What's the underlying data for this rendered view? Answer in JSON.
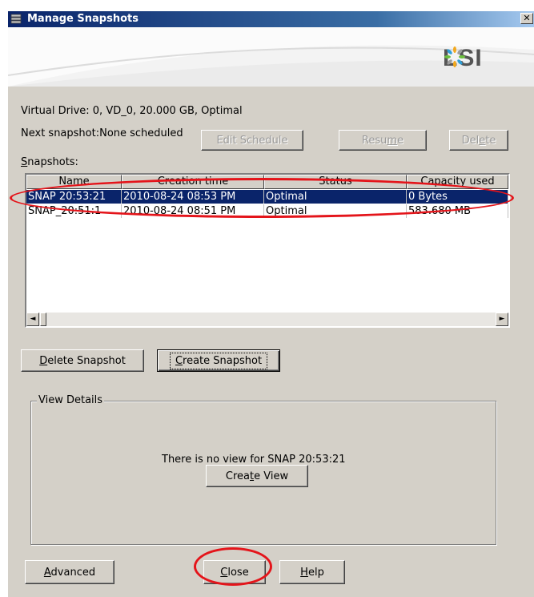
{
  "window": {
    "title": "Manage Snapshots",
    "close_glyph": "✕"
  },
  "banner": {
    "logo_text": "LSI",
    "logo_mark_colors": [
      "#6cbf3f",
      "#2d9fd8",
      "#f2a81d",
      "#9c9c9c"
    ]
  },
  "info": {
    "virtual_drive": "Virtual Drive: 0, VD_0, 20.000 GB, Optimal",
    "next_snapshot": "Next snapshot:None scheduled"
  },
  "schedule_buttons": {
    "edit_schedule": "Edit Schedule",
    "resume_pre": "Resu",
    "resume_u": "m",
    "resume_post": "e",
    "delete_pre": "Del",
    "delete_u": "e",
    "delete_post": "te"
  },
  "snapshots_label": {
    "u": "S",
    "rest": "napshots:"
  },
  "table": {
    "columns": [
      "Name",
      "Creation time",
      "Status",
      "Capacity used"
    ],
    "rows": [
      {
        "name": "SNAP 20:53:21",
        "created": "2010-08-24 08:53 PM",
        "status": "Optimal",
        "capacity": "0 Bytes",
        "selected": true
      },
      {
        "name": "SNAP_20:51:1",
        "created": "2010-08-24 08:51 PM",
        "status": "Optimal",
        "capacity": "583.680 MB",
        "selected": false
      }
    ],
    "scroll_left_glyph": "◄",
    "scroll_right_glyph": "►"
  },
  "actions": {
    "delete_snapshot_u": "D",
    "delete_snapshot_rest": "elete Snapshot",
    "create_snapshot_u": "C",
    "create_snapshot_rest": "reate Snapshot"
  },
  "view_details": {
    "legend": "View Details",
    "message": "There is no view for SNAP 20:53:21",
    "create_view_pre": "Crea",
    "create_view_u": "t",
    "create_view_post": "e View"
  },
  "footer": {
    "advanced_u": "A",
    "advanced_rest": "dvanced",
    "close_u": "C",
    "close_rest": "lose",
    "help_u": "H",
    "help_rest": "elp"
  },
  "annotation_color": "#e4141a",
  "colors": {
    "selection": "#0a246a",
    "dialog": "#d4d0c8"
  }
}
